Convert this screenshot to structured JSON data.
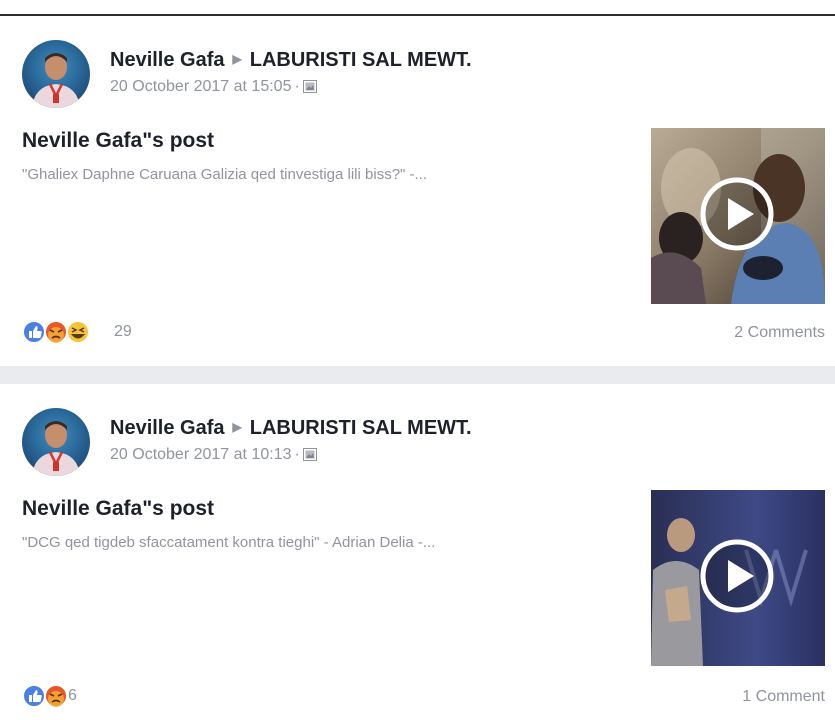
{
  "colors": {
    "name_text": "#1d2129",
    "meta_text": "#90949c",
    "like_blue": "#4a7fe8",
    "angry_orange": "#e8562a",
    "haha_yellow": "#f7c33a",
    "divider": "#e9ebee"
  },
  "posts": [
    {
      "author": "Neville Gafa",
      "group": "LABURISTI SAL MEWT.",
      "timestamp": "20 October 2017 at 15:05",
      "meta_separator": "·",
      "audience_icon": "album-icon",
      "title": "Neville Gafa\"s post",
      "excerpt": "\"Ghaliex Daphne Caruana Galizia qed tinvestiga lili biss?\" -...",
      "reaction_icons": [
        "like-icon",
        "angry-icon",
        "haha-icon"
      ],
      "reaction_count": "29",
      "comments": "2 Comments"
    },
    {
      "author": "Neville Gafa",
      "group": "LABURISTI SAL MEWT.",
      "timestamp": "20 October 2017 at 10:13",
      "meta_separator": "·",
      "audience_icon": "album-icon",
      "title": "Neville Gafa\"s post",
      "excerpt": "\"DCG qed tigdeb sfaccatament kontra tieghi\" - Adrian Delia -...",
      "reaction_icons": [
        "like-icon",
        "angry-icon"
      ],
      "reaction_count": "6",
      "comments": "1 Comment"
    }
  ]
}
